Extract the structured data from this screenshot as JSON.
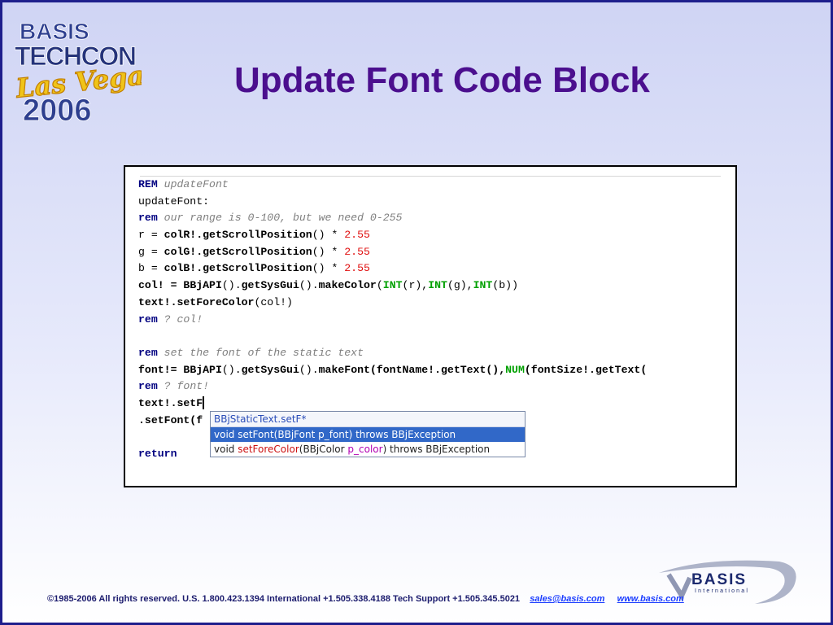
{
  "slide": {
    "title": "Update Font Code Block",
    "event_logo": {
      "line1": "BASIS",
      "line2": "TECHCON",
      "line3": "Las Vegas",
      "line4": "2006"
    },
    "company_logo": {
      "name": "BASIS",
      "tagline": "International"
    },
    "colors": {
      "title": "#4b0f8e",
      "border": "#1e1e8c",
      "keyword": "#000080",
      "comment": "#7f7f7f",
      "number": "#e01010",
      "function": "#00a000",
      "selection": "#3168c8"
    }
  },
  "code": {
    "l1_kw": "REM",
    "l1_cm": " updateFont",
    "l2": "updateFont:",
    "l3_kw": "rem",
    "l3_cm": " our range is 0-100, but we need 0-255",
    "l4_a": "r = ",
    "l4_b": "colR!.getScrollPosition",
    "l4_c": "() * ",
    "l4_num": "2.55",
    "l5_a": "g = ",
    "l5_b": "colG!.getScrollPosition",
    "l5_c": "() * ",
    "l5_num": "2.55",
    "l6_a": "b = ",
    "l6_b": "colB!.getScrollPosition",
    "l6_c": "() * ",
    "l6_num": "2.55",
    "l7_a": "col! = ",
    "l7_b": "BBjAPI",
    "l7_c": "().",
    "l7_d": "getSysGui",
    "l7_e": "().",
    "l7_f": "makeColor",
    "l7_g": "(",
    "l7_int1": "INT",
    "l7_h": "(r),",
    "l7_int2": "INT",
    "l7_i": "(g),",
    "l7_int3": "INT",
    "l7_j": "(b))",
    "l8_a": "text!.setForeColor",
    "l8_b": "(col!)",
    "l9_kw": "rem",
    "l9_cm": " ? col!",
    "l11_kw": "rem",
    "l11_cm": " set the font of the static text",
    "l12_a": "font!= ",
    "l12_b": "BBjAPI",
    "l12_c": "().",
    "l12_d": "getSysGui",
    "l12_e": "().",
    "l12_f": "makeFont",
    "l12_g": "(fontName!.getText(),",
    "l12_num": "NUM",
    "l12_h": "(fontSize!.getText(",
    "l13_kw": "rem",
    "l13_cm": " ? font!",
    "l14": "text!.setF",
    "l15": ".setFont(f",
    "l17_kw": "return"
  },
  "autocomplete": {
    "header": "BBjStaticText.setF*",
    "item1": "void setFont(BBjFont p_font) throws BBjException",
    "item2_void": "void ",
    "item2_name": "setForeColor",
    "item2_open": "(BBjColor ",
    "item2_param": "p_color",
    "item2_rest": ") throws BBjException"
  },
  "footer": {
    "copyright": "©1985-2006  All rights reserved.   U.S. 1.800.423.1394    International +1.505.338.4188   Tech Support +1.505.345.5021",
    "email": "sales@basis.com",
    "website": "www.basis.com"
  }
}
